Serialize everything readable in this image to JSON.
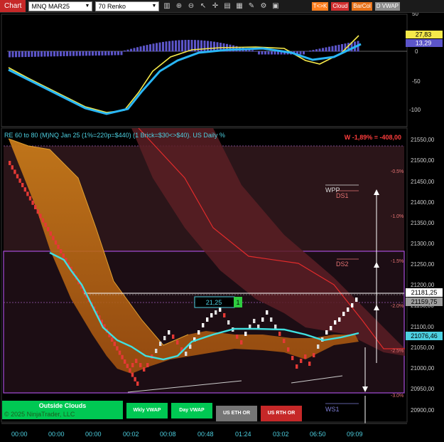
{
  "toolbar": {
    "chart_tab": "Chart",
    "instrument": "MNQ MAR25",
    "bar_type": "70 Renko",
    "badges": [
      {
        "label": "T<>K",
        "color": "#ff7f1f"
      },
      {
        "label": "Cloud",
        "color": "#d32f2f"
      },
      {
        "label": "BarCol",
        "color": "#e8731a"
      },
      {
        "label": "D VWAP",
        "color": "#8d8d8d"
      }
    ]
  },
  "indicator_panel": {
    "y_labels": [
      "50",
      "0",
      "-50",
      "-100"
    ],
    "badge_yellow": "27,83",
    "badge_blue": "13,29",
    "colors": {
      "yellow": "#f5e94a",
      "blue": "#29b6f6",
      "hist": "#5c55c9"
    }
  },
  "price_panel": {
    "title": "RE 60 to 80 (M)NQ Jan 25 (1%=220p=$440) (1 Brick=$30<>$40). US Daily %",
    "weekly_pct": "W -1,89% = -408,00",
    "y_labels": [
      "21550,00",
      "21500,00",
      "21450,00",
      "21400,00",
      "21350,00",
      "21300,00",
      "21250,00",
      "21200,00",
      "21150,00",
      "21100,00",
      "21050,00",
      "21000,00",
      "20950,00",
      "20900,00"
    ],
    "pct_labels": [
      "-0.5%",
      "-1.0%",
      "-1.5%",
      "-2.0%",
      "-2.5%",
      "-3.0%"
    ],
    "price_badge_white": "21181,25",
    "price_badge_gray": "21159,75",
    "price_badge_cyan": "21076,46",
    "levels": {
      "wpp": "WPP",
      "ds1": "DS1",
      "ds2": "DS2",
      "ws1": "WS1"
    },
    "tooltip_value": "21,25",
    "tooltip_count": "1",
    "buttons": {
      "outside_clouds": "Outside Clouds",
      "copyright": "© 2025 NinjaTrader, LLC",
      "wkly_vwap": "Wkly VWAP",
      "day_vwap": "Day VWAP",
      "us_eth_or": "US ETH OR",
      "us_rth_or": "US RTH OR"
    }
  },
  "x_axis": [
    "00:00",
    "00:00",
    "00:00",
    "00:02",
    "00:08",
    "00:48",
    "01:24",
    "03:02",
    "06:50",
    "09:09"
  ]
}
